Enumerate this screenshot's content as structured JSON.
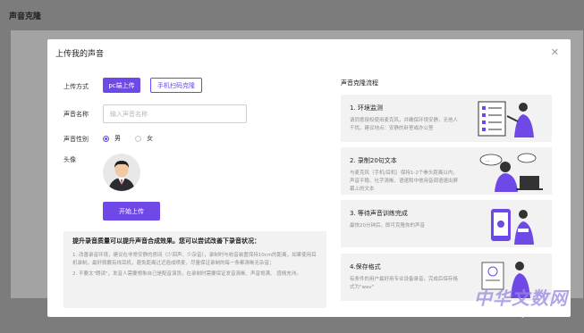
{
  "page": {
    "title": "声音克隆"
  },
  "modal": {
    "title": "上传我的声音",
    "close_icon": "close-icon"
  },
  "form": {
    "upload_label": "上传方式",
    "pc_upload_button": "pc端上传",
    "mobile_button": "手机扫码克隆",
    "name_label": "声音名称",
    "name_placeholder": "输入声音名称",
    "name_value": "",
    "gender_label": "声音性别",
    "gender_options": [
      "男",
      "女"
    ],
    "gender_selected": "男",
    "avatar_label": "头像",
    "start_button": "开始上传"
  },
  "tips": {
    "title": "提升录音质量可以提升声音合成效果。您可以尝试改善下录音状况：",
    "items": [
      "1. 改善录音环境，建议在非常安静的房间（少回声、少杂音），录制时与收音装置保持10cm的距离，如果使用耳机录制，最好佩戴有线耳机，避免距离过近造成喷麦，尽量保证录制的每一条都清晰无杂音；",
      "2. 不要太\"朗读\"，发音人需要想象自己是配音演员，在录制时需要保证发音清晰、声音饱满、 感情充沛。"
    ]
  },
  "flow": {
    "title": "声音克隆流程",
    "steps": [
      {
        "name": "1. 环境监测",
        "desc": "请同意授权使用麦克风，并确保环境安静，无他人干扰。建议地点：安静的卧室或办公室"
      },
      {
        "name": "2. 录制20句文本",
        "desc": "与麦克风（手机/耳机）保持1-2个拳头距离以内，声音平稳、吐字清晰、语速和中他用音调语速出屏幕上的文本"
      },
      {
        "name": "3. 等待声音训练完成",
        "desc": "最快20分钟后，即可克隆你的声音"
      },
      {
        "name": "4.保存格式",
        "desc": "有条件的用户最好用专业设备录音，完成后保存格式为\"wav\""
      }
    ]
  },
  "watermark": {
    "brand": "中华文数网",
    "url": "www.zhwjw.net"
  },
  "colors": {
    "accent": "#6f48e8",
    "overlay": "#7c7c7c",
    "panel": "#f2f2f2"
  }
}
